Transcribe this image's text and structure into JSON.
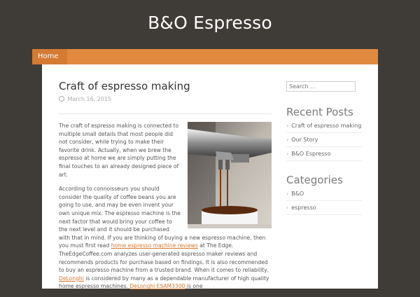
{
  "site": {
    "title": "B&O Espresso"
  },
  "nav": {
    "items": [
      {
        "label": "Home"
      }
    ]
  },
  "post": {
    "title": "Craft of espresso making",
    "date": "March 16, 2015",
    "p1": "The craft of espresso making is connected to multiple small details that most people did not consider, while trying to make their favorite drink. Actually, when we brew the espresso at home we are simply putting the final touches to an already designed piece of art.",
    "p2_a": "According to connoisseurs you should consider the quality of coffee beans you are going to use, and may be even invent your own unique mix. The espresso machine is the next factor that would bring your coffee to the next level and it should be purchased with that in mind.  If you are thinking of buying a new espresso machine, then you must first read ",
    "link1": "home espresso machine reviews",
    "p2_b": " at The Edge. TheEdgeCoffee.com analyzes user-generated espresso maker reviews and recommends products for purchase based on findings. It is also recommended to buy an espresso machine from a trusted brand. When it comes to reliability, ",
    "link2": "DeLonghi",
    "p2_c": " is considered by many as a dependable manufacturer of high quality home espresso machines. ",
    "link3": "DeLonghi ESAM3300",
    "p2_d": " is one"
  },
  "sidebar": {
    "search_placeholder": "Search ...",
    "recent_title": "Recent Posts",
    "recent": [
      "Craft of espresso making",
      "Our Story",
      "B&O Espresso"
    ],
    "categories_title": "Categories",
    "categories": [
      "B&O",
      "espresso"
    ]
  }
}
